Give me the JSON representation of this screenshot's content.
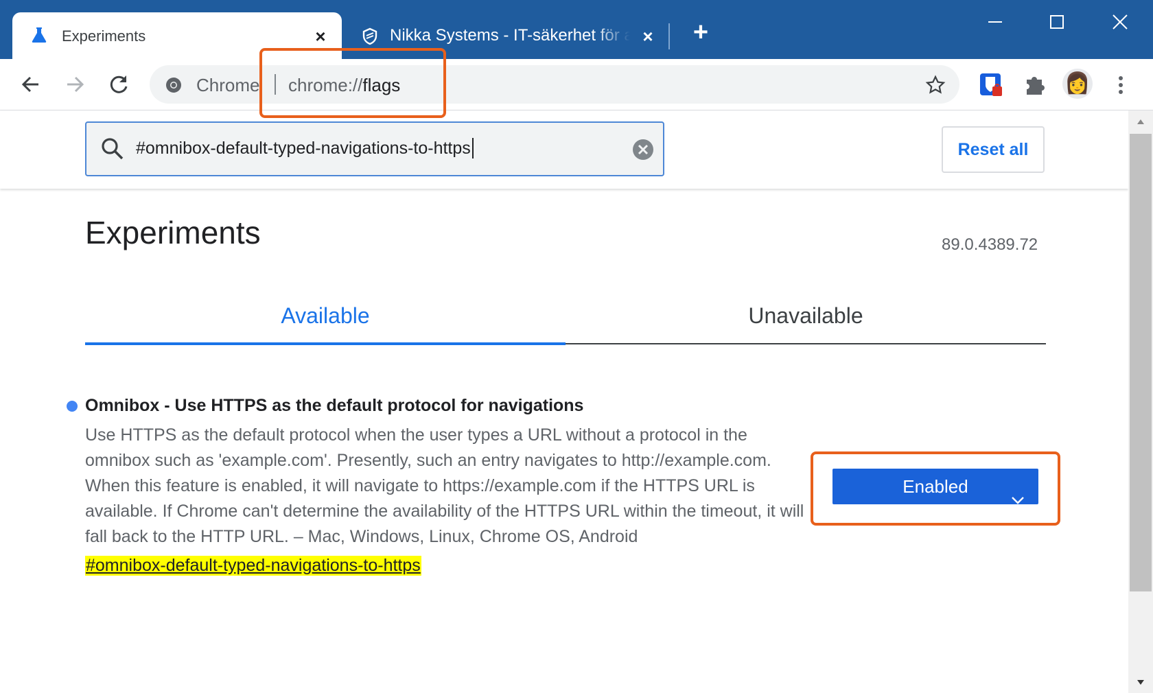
{
  "browser": {
    "tabs": [
      {
        "title": "Experiments",
        "icon": "flask-icon",
        "active": true
      },
      {
        "title": "Nikka Systems - IT-säkerhet för alla",
        "icon": "shield-icon",
        "active": false
      }
    ],
    "omnibox": {
      "chip": "Chrome",
      "url_scheme": "chrome://",
      "url_path": "flags"
    },
    "avatar": "👩"
  },
  "page": {
    "search": {
      "value": "#omnibox-default-typed-navigations-to-https"
    },
    "reset_label": "Reset all",
    "heading": "Experiments",
    "version": "89.0.4389.72",
    "tabs": [
      {
        "label": "Available",
        "selected": true
      },
      {
        "label": "Unavailable",
        "selected": false
      }
    ],
    "flag": {
      "title": "Omnibox - Use HTTPS as the default protocol for navigations",
      "description": "Use HTTPS as the default protocol when the user types a URL without a protocol in the omnibox such as 'example.com'. Presently, such an entry navigates to http://example.com. When this feature is enabled, it will navigate to https://example.com if the HTTPS URL is available. If Chrome can't determine the availability of the HTTPS URL within the timeout, it will fall back to the HTTP URL. – Mac, Windows, Linux, Chrome OS, Android",
      "link": "#omnibox-default-typed-navigations-to-https",
      "state": "Enabled"
    }
  },
  "colors": {
    "titlebar": "#1f5c9e",
    "accent": "#1a73e8",
    "annotation": "#e8601c",
    "highlight": "#ffff00"
  }
}
